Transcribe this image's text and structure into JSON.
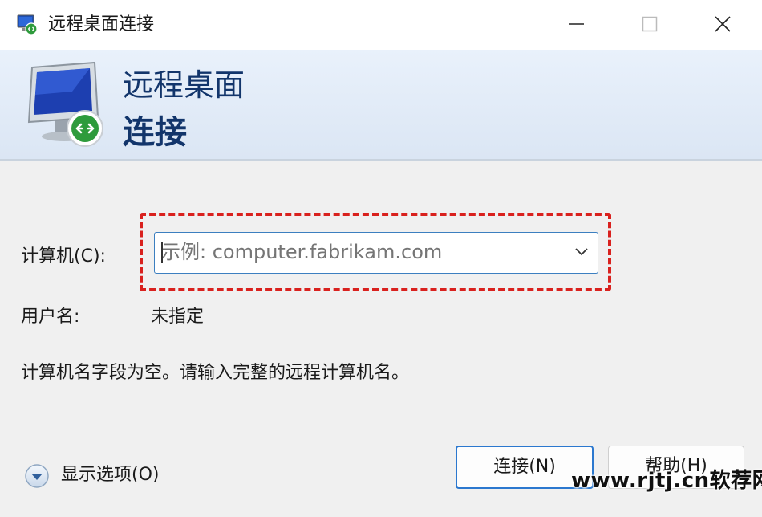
{
  "window": {
    "title": "远程桌面连接",
    "icon": "remote-desktop-icon",
    "controls": {
      "minimize": "minimize-icon",
      "maximize": "maximize-icon",
      "close": "close-icon"
    }
  },
  "banner": {
    "line1": "远程桌面",
    "line2": "连接",
    "icon": "monitor-remote-icon",
    "title_color": "#12356b"
  },
  "form": {
    "computer_label": "计算机(C):",
    "computer_placeholder": "示例: computer.fabrikam.com",
    "computer_value": "",
    "user_label": "用户名:",
    "user_value": "未指定",
    "message": "计算机名字段为空。请输入完整的远程计算机名。"
  },
  "options": {
    "label": "显示选项(O)",
    "icon": "expand-chevron-icon"
  },
  "buttons": {
    "connect": "连接(N)",
    "help": "帮助(H)"
  },
  "highlight_color": "#d9211e",
  "accent_color": "#2b78cf",
  "watermark": "www.rjtj.cn软荐网"
}
